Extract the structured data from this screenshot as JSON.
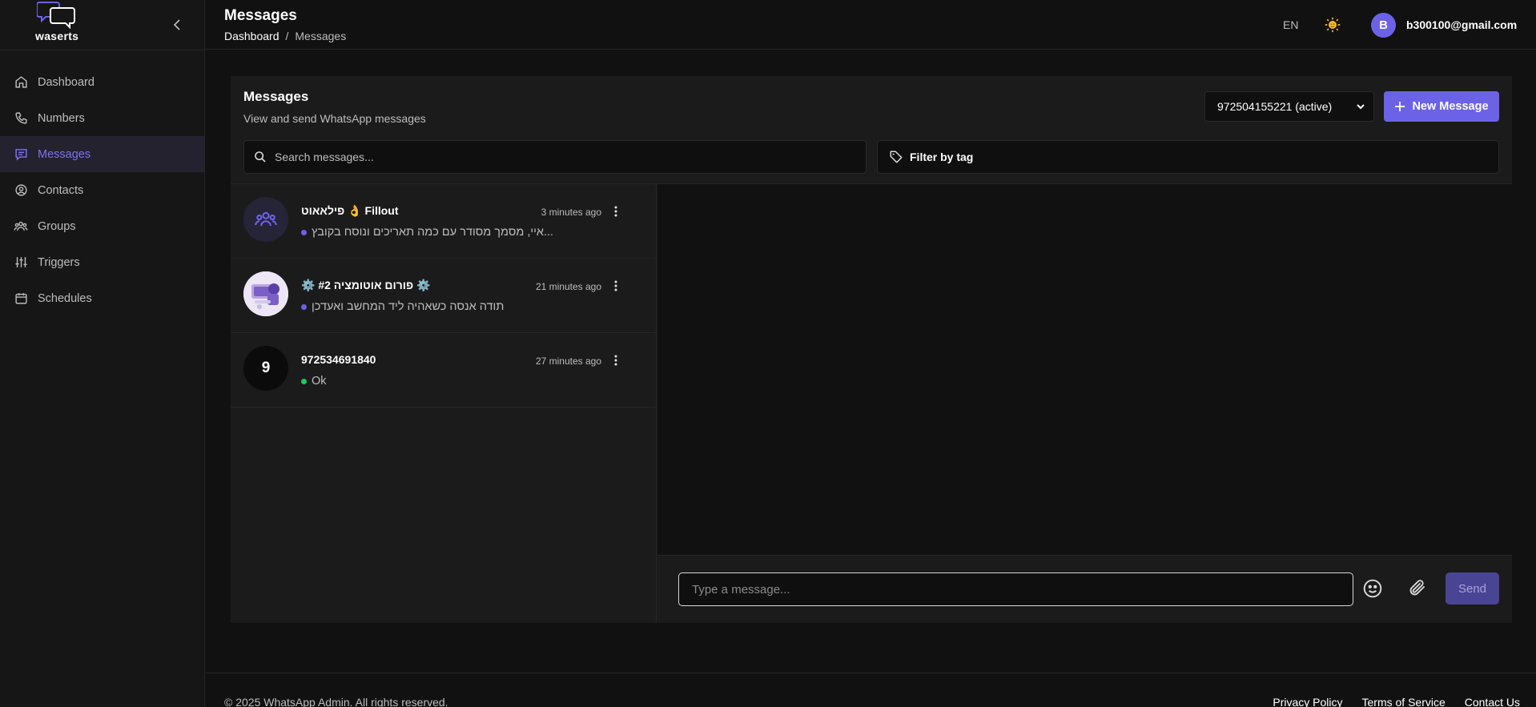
{
  "app": {
    "logo_text": "waserts"
  },
  "sidebar": {
    "items": [
      {
        "label": "Dashboard",
        "icon": "home-icon"
      },
      {
        "label": "Numbers",
        "icon": "phone-icon"
      },
      {
        "label": "Messages",
        "icon": "message-icon",
        "active": true
      },
      {
        "label": "Contacts",
        "icon": "contact-circle-icon"
      },
      {
        "label": "Groups",
        "icon": "users-icon"
      },
      {
        "label": "Triggers",
        "icon": "sliders-icon"
      },
      {
        "label": "Schedules",
        "icon": "calendar-icon"
      }
    ]
  },
  "header": {
    "title": "Messages",
    "breadcrumb": {
      "root": "Dashboard",
      "separator": "/",
      "current": "Messages"
    },
    "language": "EN",
    "theme_icon": "sun-icon",
    "user": {
      "avatar_letter": "B",
      "email": "b300100@gmail.com"
    }
  },
  "card": {
    "title": "Messages",
    "subtitle": "View and send WhatsApp messages",
    "number_select": {
      "selected": "972504155221 (active)"
    },
    "new_message_label": "New Message",
    "search": {
      "placeholder": "Search messages..."
    },
    "filter_label": "Filter by tag"
  },
  "conversations": [
    {
      "name": "פילאאוט 👌 Fillout",
      "time": "3 minutes ago",
      "preview": "איי, מסמך מסודר עם כמה תאריכים ונוסח בקובץ...",
      "avatar_type": "group-icon",
      "status_color": "#6b62e8"
    },
    {
      "name": "⚙️ פורום אוטומציה #2 ⚙️",
      "time": "21 minutes ago",
      "preview": "תודה אנסה כשאהיה ליד המחשב ואעדכן",
      "avatar_type": "image",
      "status_color": "#6b62e8"
    },
    {
      "name": "972534691840",
      "time": "27 minutes ago",
      "preview": "Ok",
      "avatar_letter": "9",
      "avatar_type": "letter",
      "status_color": "#22c55e"
    }
  ],
  "composer": {
    "placeholder": "Type a message...",
    "send_label": "Send"
  },
  "footer": {
    "copyright": "© 2025 WhatsApp Admin. All rights reserved.",
    "links": [
      "Privacy Policy",
      "Terms of Service",
      "Contact Us"
    ]
  },
  "colors": {
    "accent": "#6b62e8",
    "online": "#22c55e",
    "background": "#111111",
    "panel": "#1b1b1b"
  }
}
